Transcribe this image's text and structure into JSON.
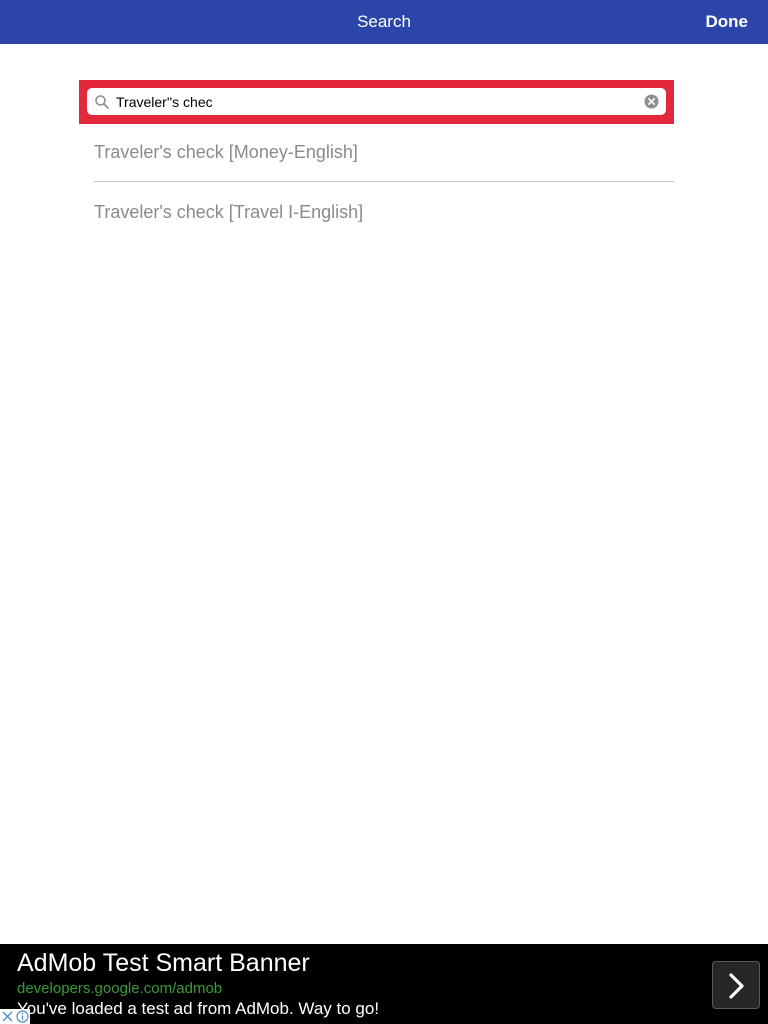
{
  "nav": {
    "title": "Search",
    "done_label": "Done"
  },
  "search": {
    "value": "Traveler''s chec",
    "icon": "search-icon",
    "clear_icon": "clear-icon"
  },
  "results": [
    {
      "label": "Traveler's check [Money-English]"
    },
    {
      "label": "Traveler's check [Travel I-English]"
    }
  ],
  "ad": {
    "title": "AdMob Test Smart Banner",
    "url": "developers.google.com/admob",
    "description": "You've loaded a test ad from AdMob. Way to go!"
  },
  "colors": {
    "nav_background": "#2c45a8",
    "search_frame": "#e4283c",
    "result_text": "#8a8a8f",
    "ad_url": "#3a9a3a"
  }
}
